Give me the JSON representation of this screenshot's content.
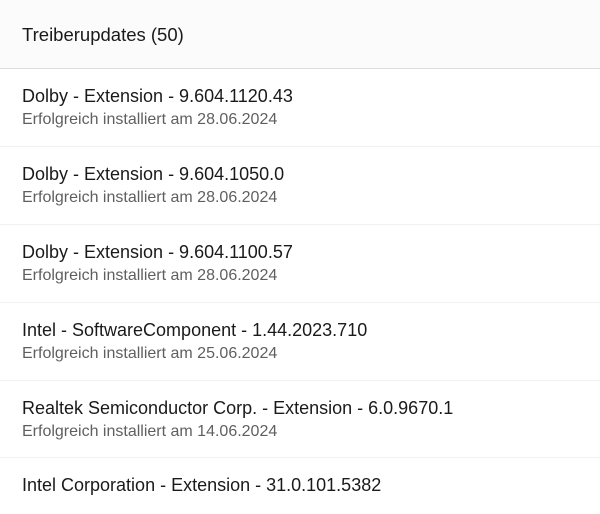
{
  "header": {
    "title": "Treiberupdates (50)"
  },
  "items": [
    {
      "title": "Dolby - Extension - 9.604.1120.43",
      "status": "Erfolgreich installiert am 28.06.2024"
    },
    {
      "title": "Dolby - Extension - 9.604.1050.0",
      "status": "Erfolgreich installiert am 28.06.2024"
    },
    {
      "title": "Dolby - Extension - 9.604.1100.57",
      "status": "Erfolgreich installiert am 28.06.2024"
    },
    {
      "title": "Intel - SoftwareComponent - 1.44.2023.710",
      "status": "Erfolgreich installiert am 25.06.2024"
    },
    {
      "title": "Realtek Semiconductor Corp. - Extension - 6.0.9670.1",
      "status": "Erfolgreich installiert am 14.06.2024"
    },
    {
      "title": "Intel Corporation - Extension - 31.0.101.5382",
      "status": ""
    }
  ]
}
